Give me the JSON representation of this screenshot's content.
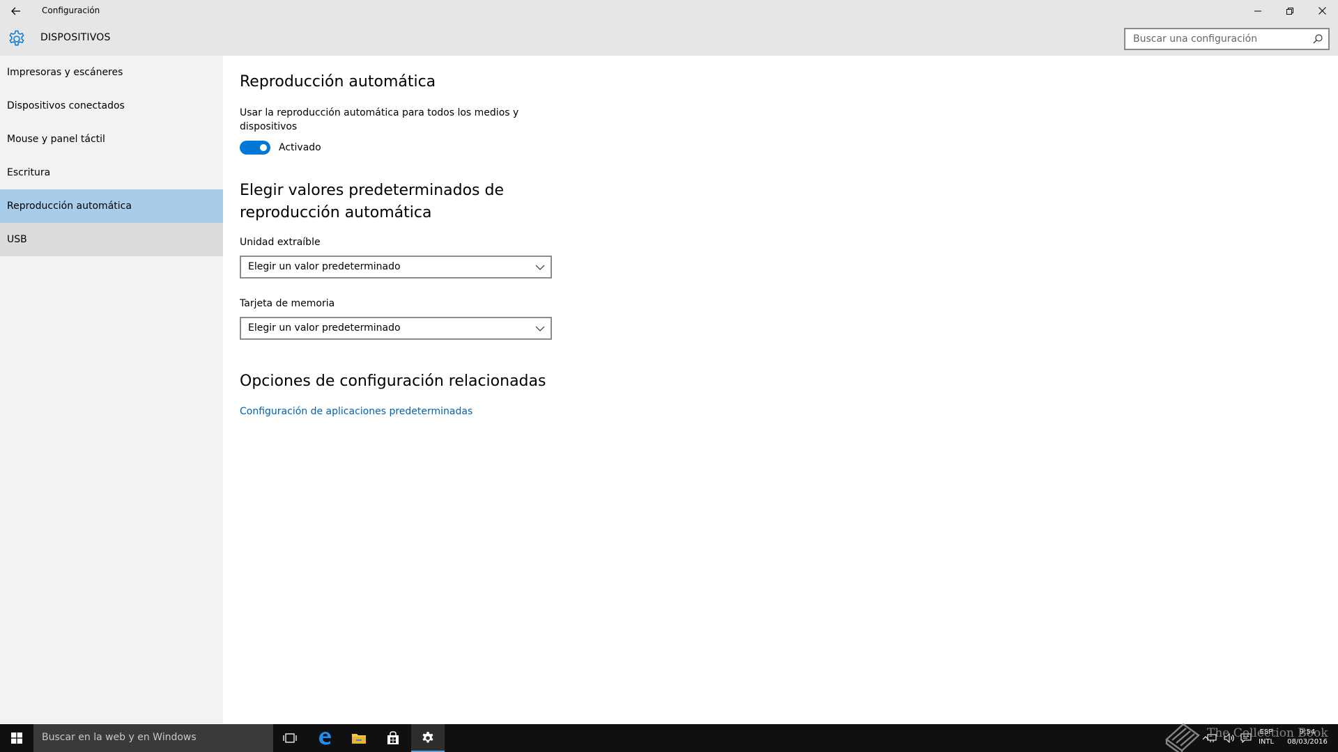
{
  "window": {
    "title": "Configuración",
    "section": "DISPOSITIVOS"
  },
  "search": {
    "placeholder": "Buscar una configuración"
  },
  "sidebar": {
    "items": [
      {
        "label": "Impresoras y escáneres"
      },
      {
        "label": "Dispositivos conectados"
      },
      {
        "label": "Mouse y panel táctil"
      },
      {
        "label": "Escritura"
      },
      {
        "label": "Reproducción automática"
      },
      {
        "label": "USB"
      }
    ],
    "selected": "Reproducción automática"
  },
  "main": {
    "heading": "Reproducción automática",
    "description": "Usar la reproducción automática para todos los medios y dispositivos",
    "toggle": {
      "state": "on",
      "label": "Activado"
    },
    "defaults_heading_line1": "Elegir valores predeterminados de",
    "defaults_heading_line2": "reproducción automática",
    "removable": {
      "label": "Unidad extraíble",
      "value": "Elegir un valor predeterminado"
    },
    "memory_card": {
      "label": "Tarjeta de memoria",
      "value": "Elegir un valor predeterminado"
    },
    "related_heading": "Opciones de configuración relacionadas",
    "related_link": "Configuración de aplicaciones predeterminadas"
  },
  "taskbar": {
    "search_placeholder": "Buscar en la web y en Windows",
    "lang_line1": "ESP",
    "lang_line2": "INTL",
    "time": "9:54",
    "date": "08/03/2016",
    "watermark": "The Collection Book"
  },
  "colors": {
    "accent": "#0078d7",
    "selected_nav": "#a8cdea",
    "link": "#0063b1"
  },
  "icons": {
    "back": "back-arrow-icon",
    "minimize": "minimize-icon",
    "restore": "restore-icon",
    "close": "close-icon",
    "settings": "gear-icon",
    "search": "search-icon",
    "dropdown": "chevron-down-icon",
    "start": "windows-start-icon",
    "task_view": "task-view-icon",
    "edge": "edge-icon",
    "explorer": "folder-icon",
    "store": "store-icon",
    "settings_app": "gear-icon"
  }
}
